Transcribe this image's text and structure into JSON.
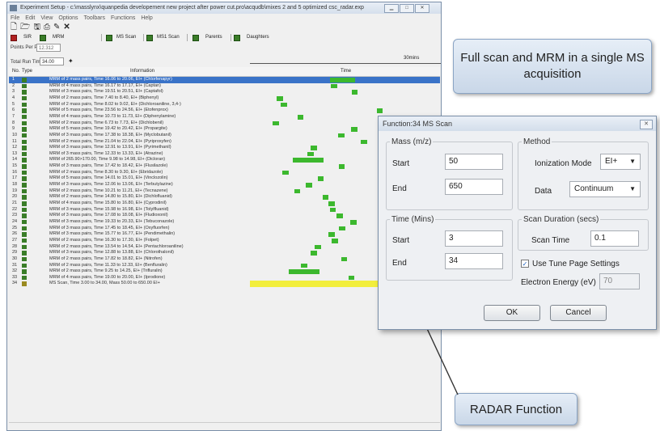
{
  "window": {
    "title": "Experiment Setup - c:\\masslynx\\quanpedia developement new project after power cut.pro\\acqudb\\mixes 2 and 5 optimized csc_radar.exp",
    "menu": [
      "File",
      "Edit",
      "View",
      "Options",
      "Toolbars",
      "Functions",
      "Help"
    ],
    "toolbar_buttons": [
      "SIR",
      "MRM",
      "MS Scan",
      "MS1 Scan",
      "Parents",
      "Daughters"
    ],
    "points_per_peak_label": "Points Per Peak:",
    "points_per_peak_value": "12.312",
    "total_run_time_label": "Total Run Time:",
    "total_run_time_value": "34.00",
    "time_scale_label": "30mins"
  },
  "table": {
    "headers": {
      "no": "No.",
      "type": "Type",
      "information": "Information",
      "time": "Time"
    },
    "rows": [
      {
        "no": "1",
        "type": "mrm",
        "info": "MRM of 2 mass pairs, Time 16.06 to 20.06, EI+ (Chlorfenapyr)",
        "start": 16.06,
        "end": 20.06
      },
      {
        "no": "2",
        "type": "mrm",
        "info": "MRM of 4 mass pairs, Time 16.17 to 17.17, EI+ (Captan)",
        "start": 16.17,
        "end": 17.17
      },
      {
        "no": "3",
        "type": "mrm",
        "info": "MRM of 3 mass pairs, Time 19.51 to 20.51, EI+ (Captafol)",
        "start": 19.51,
        "end": 20.51
      },
      {
        "no": "4",
        "type": "mrm",
        "info": "MRM of 2 mass pairs, Time 7.40 to 8.40, EI+ (Biphenyl)",
        "start": 7.4,
        "end": 8.4
      },
      {
        "no": "5",
        "type": "mrm",
        "info": "MRM of 2 mass pairs, Time 8.02 to 9.02, EI+ (Dichloroaniline, 3,4-)",
        "start": 8.02,
        "end": 9.02
      },
      {
        "no": "6",
        "type": "mrm",
        "info": "MRM of 5 mass pairs, Time 23.56 to 24.56, EI+ (Etofenprox)",
        "start": 23.56,
        "end": 24.56
      },
      {
        "no": "7",
        "type": "mrm",
        "info": "MRM of 4 mass pairs, Time 10.73 to 11.73, EI+ (Diphenylamine)",
        "start": 10.73,
        "end": 11.73
      },
      {
        "no": "8",
        "type": "mrm",
        "info": "MRM of 2 mass pairs, Time 6.73 to 7.73, EI+ (Dichlobenil)",
        "start": 6.73,
        "end": 7.73
      },
      {
        "no": "9",
        "type": "mrm",
        "info": "MRM of 5 mass pairs, Time 19.42 to 20.42, EI+ (Propargite)",
        "start": 19.42,
        "end": 20.42
      },
      {
        "no": "10",
        "type": "mrm",
        "info": "MRM of 3 mass pairs, Time 17.38 to 18.38, EI+ (Myclobutanil)",
        "start": 17.38,
        "end": 18.38
      },
      {
        "no": "11",
        "type": "mrm",
        "info": "MRM of 2 mass pairs, Time 21.04 to 22.04, EI+ (Pyriproxyfen)",
        "start": 21.04,
        "end": 22.04
      },
      {
        "no": "12",
        "type": "mrm",
        "info": "MRM of 3 mass pairs, Time 12.91 to 13.91, EI+ (Pyrimethanil)",
        "start": 12.91,
        "end": 13.91
      },
      {
        "no": "13",
        "type": "mrm",
        "info": "MRM of 3 mass pairs, Time 12.33 to 13.33, EI+ (Atrazine)",
        "start": 12.33,
        "end": 13.33
      },
      {
        "no": "14",
        "type": "mrm",
        "info": "MRM of 265.90>170.00, Time 9.98 to 14.98, EI+ (Dicloran)",
        "start": 9.98,
        "end": 14.98
      },
      {
        "no": "15",
        "type": "mrm",
        "info": "MRM of 3 mass pairs, Time 17.42 to 18.42, EI+ (Flusilazole)",
        "start": 17.42,
        "end": 18.42
      },
      {
        "no": "16",
        "type": "mrm",
        "info": "MRM of 2 mass pairs, Time 8.30 to 9.30, EI+ (Ebridazole)",
        "start": 8.3,
        "end": 9.3
      },
      {
        "no": "17",
        "type": "mrm",
        "info": "MRM of 5 mass pairs, Time 14.01 to 15.01, EI+ (Vinclozolin)",
        "start": 14.01,
        "end": 15.01
      },
      {
        "no": "18",
        "type": "mrm",
        "info": "MRM of 3 mass pairs, Time 12.06 to 13.06, EI+ (Terbutylazine)",
        "start": 12.06,
        "end": 13.06
      },
      {
        "no": "19",
        "type": "mrm",
        "info": "MRM of 2 mass pairs, Time 10.21 to 11.21, EI+ (Tecnazene)",
        "start": 10.21,
        "end": 11.21
      },
      {
        "no": "20",
        "type": "mrm",
        "info": "MRM of 2 mass pairs, Time 14.80 to 15.80, EI+ (Dichlofluanid)",
        "start": 14.8,
        "end": 15.8
      },
      {
        "no": "21",
        "type": "mrm",
        "info": "MRM of 4 mass pairs, Time 15.80 to 16.80, EI+ (Cyprodinil)",
        "start": 15.8,
        "end": 16.8
      },
      {
        "no": "22",
        "type": "mrm",
        "info": "MRM of 3 mass pairs, Time 15.98 to 16.98, EI+ (Tolylfluanid)",
        "start": 15.98,
        "end": 16.98
      },
      {
        "no": "23",
        "type": "mrm",
        "info": "MRM of 3 mass pairs, Time 17.08 to 18.08, EI+ (Fludioxonil)",
        "start": 17.08,
        "end": 18.08
      },
      {
        "no": "24",
        "type": "mrm",
        "info": "MRM of 3 mass pairs, Time 19.33 to 20.33, EI+ (Tebuconazole)",
        "start": 19.33,
        "end": 20.33
      },
      {
        "no": "25",
        "type": "mrm",
        "info": "MRM of 3 mass pairs, Time 17.45 to 18.45, EI+ (Oxyfluorfen)",
        "start": 17.45,
        "end": 18.45
      },
      {
        "no": "26",
        "type": "mrm",
        "info": "MRM of 3 mass pairs, Time 15.77 to 16.77, EI+ (Pendimethalin)",
        "start": 15.77,
        "end": 16.77
      },
      {
        "no": "27",
        "type": "mrm",
        "info": "MRM of 2 mass pairs, Time 16.30 to 17.30, EI+ (Folpet)",
        "start": 16.3,
        "end": 17.3
      },
      {
        "no": "28",
        "type": "mrm",
        "info": "MRM of 2 mass pairs, Time 13.54 to 14.54, EI+ (Pentachloroaniline)",
        "start": 13.54,
        "end": 14.54
      },
      {
        "no": "29",
        "type": "mrm",
        "info": "MRM of 3 mass pairs, Time 12.88 to 13.88, EI+ (Chlorothalonil)",
        "start": 12.88,
        "end": 13.88
      },
      {
        "no": "30",
        "type": "mrm",
        "info": "MRM of 2 mass pairs, Time 17.82 to 18.82, EI+ (Nitrofen)",
        "start": 17.82,
        "end": 18.82
      },
      {
        "no": "31",
        "type": "mrm",
        "info": "MRM of 2 mass pairs, Time 11.33 to 12.33, EI+ (Benfluralin)",
        "start": 11.33,
        "end": 12.33
      },
      {
        "no": "32",
        "type": "mrm",
        "info": "MRM of 2 mass pairs, Time 9.25 to 14.25, EI+ (Trifluralin)",
        "start": 9.25,
        "end": 14.25
      },
      {
        "no": "33",
        "type": "mrm",
        "info": "MRM of 4 mass pairs, Time 19.00 to 20.00, EI+ (Iprodione)",
        "start": 19.0,
        "end": 20.0
      },
      {
        "no": "34",
        "type": "scan",
        "info": "MS Scan, Time 3.00 to 34.00, Mass 50.00 to 650.00 EI+",
        "start": 3.0,
        "end": 34.0
      }
    ]
  },
  "dialog": {
    "title": "Function:34 MS Scan",
    "mass_group": "Mass (m/z)",
    "mass_start_label": "Start",
    "mass_start_value": "50",
    "mass_end_label": "End",
    "mass_end_value": "650",
    "method_group": "Method",
    "ionization_label": "Ionization Mode",
    "ionization_value": "EI+",
    "data_label": "Data",
    "data_value": "Continuum",
    "time_group": "Time (Mins)",
    "time_start_label": "Start",
    "time_start_value": "3",
    "time_end_label": "End",
    "time_end_value": "34",
    "scan_group": "Scan Duration (secs)",
    "scan_time_label": "Scan Time",
    "scan_time_value": "0.1",
    "tune_page_label": "Use Tune Page Settings",
    "tune_page_checked": true,
    "electron_energy_label": "Electron Energy (eV)",
    "electron_energy_value": "70",
    "ok_label": "OK",
    "cancel_label": "Cancel"
  },
  "callouts": {
    "top": "Full scan and MRM in a single MS acquisition",
    "bottom": "RADAR Function"
  },
  "colors": {
    "selected_row": "#3a73c8",
    "mrm_bar": "#3cb82e",
    "scan_bar": "#f2ee3c"
  }
}
